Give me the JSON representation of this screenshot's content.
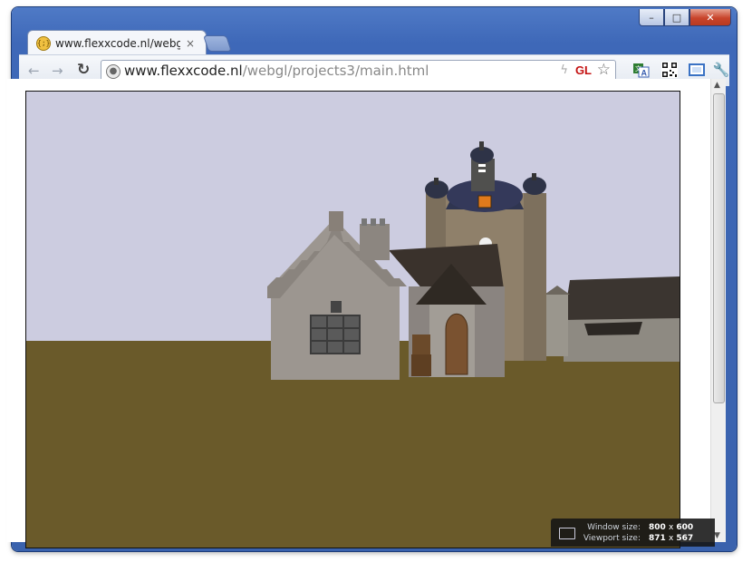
{
  "window": {
    "minimize_glyph": "–",
    "maximize_glyph": "□",
    "close_glyph": "✕"
  },
  "tab": {
    "title": "www.flexxcode.nl/webgl/pr",
    "favicon_text": "{;}",
    "close_glyph": "×"
  },
  "toolbar": {
    "back_glyph": "←",
    "forward_glyph": "→",
    "reload_glyph": "↻",
    "url_host": "www.flexxcode.nl",
    "url_path": "/webgl/projects3/main.html",
    "gl_badge": "GL",
    "star_glyph": "☆",
    "wrench_glyph": "🔧"
  },
  "extensions": [
    "translate-icon",
    "qr-code-icon",
    "window-resizer-icon",
    "wrench-icon"
  ],
  "resize_overlay": {
    "window_label": "Window size:",
    "window_w": "800",
    "window_h": "600",
    "viewport_label": "Viewport size:",
    "viewport_w": "871",
    "viewport_h": "567",
    "times": "x"
  },
  "scene": {
    "sky_color": "#cccce0",
    "ground_color": "#6a5a2a"
  }
}
